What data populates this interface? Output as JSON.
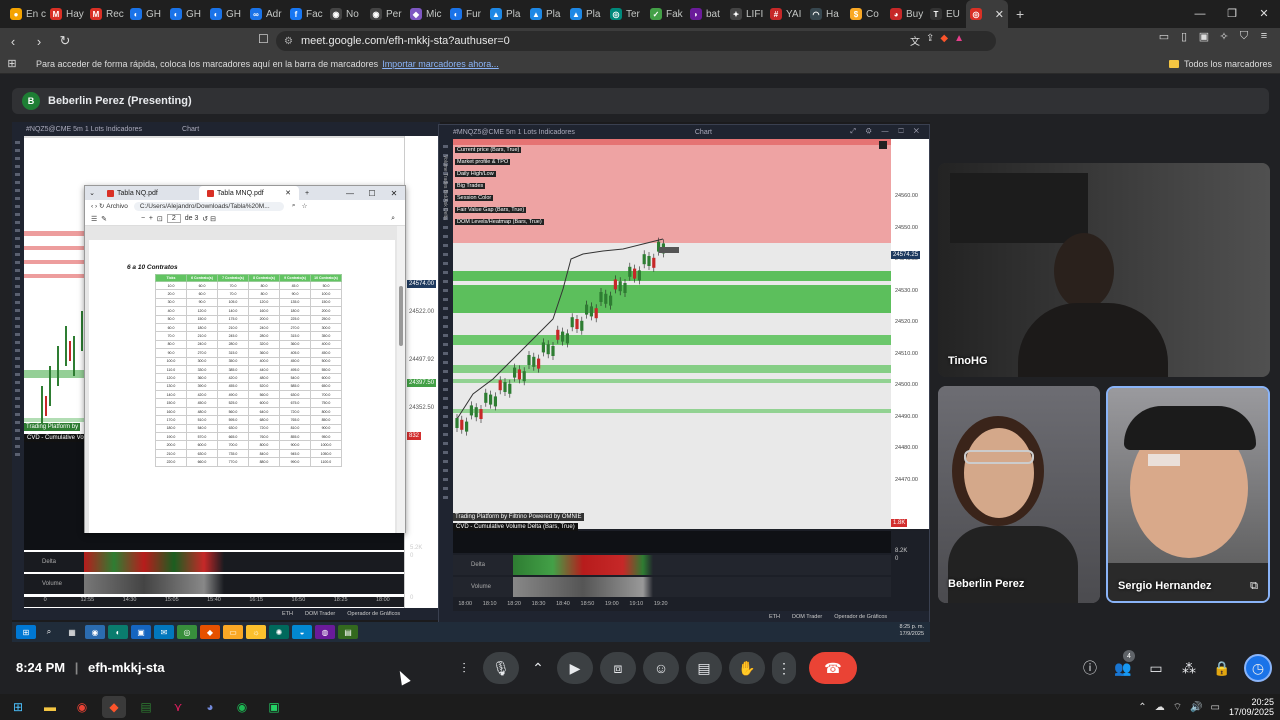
{
  "browser": {
    "tabs": [
      {
        "label": "En c",
        "color": "#f4a300",
        "glyph": "●"
      },
      {
        "label": "Hay",
        "color": "#d93025",
        "glyph": "M"
      },
      {
        "label": "Rec",
        "color": "#d93025",
        "glyph": "M"
      },
      {
        "label": "GH",
        "color": "#1a73e8",
        "glyph": "◐"
      },
      {
        "label": "GH",
        "color": "#1a73e8",
        "glyph": "◐"
      },
      {
        "label": "GH",
        "color": "#1a73e8",
        "glyph": "◐"
      },
      {
        "label": "Adr",
        "color": "#1a73e8",
        "glyph": "∞"
      },
      {
        "label": "Fac",
        "color": "#1877f2",
        "glyph": "f"
      },
      {
        "label": "No",
        "color": "#444",
        "glyph": "◉"
      },
      {
        "label": "Per",
        "color": "#444",
        "glyph": "◉"
      },
      {
        "label": "Mic",
        "color": "#7e57c2",
        "glyph": "◆"
      },
      {
        "label": "Fur",
        "color": "#1a73e8",
        "glyph": "◐"
      },
      {
        "label": "Pla",
        "color": "#1e88e5",
        "glyph": "▲"
      },
      {
        "label": "Pla",
        "color": "#1e88e5",
        "glyph": "▲"
      },
      {
        "label": "Pla",
        "color": "#1e88e5",
        "glyph": "▲"
      },
      {
        "label": "Ter",
        "color": "#00897b",
        "glyph": "◎"
      },
      {
        "label": "Fak",
        "color": "#43a047",
        "glyph": "✓"
      },
      {
        "label": "bat",
        "color": "#6a1b9a",
        "glyph": "◗"
      },
      {
        "label": "LIFI",
        "color": "#444",
        "glyph": "✦"
      },
      {
        "label": "YAI",
        "color": "#c62828",
        "glyph": "#"
      },
      {
        "label": "Ha",
        "color": "#37474f",
        "glyph": "◠"
      },
      {
        "label": "Co",
        "color": "#f9a825",
        "glyph": "$"
      },
      {
        "label": "Buy",
        "color": "#c62828",
        "glyph": "◕"
      },
      {
        "label": "EU",
        "color": "#333",
        "glyph": "T"
      },
      {
        "label": "",
        "color": "#d93025",
        "glyph": "◎",
        "active": true
      }
    ],
    "url": "meet.google.com/efh-mkkj-sta?authuser=0",
    "bookmarks_hint": "Para acceder de forma rápida, coloca los marcadores aquí en la barra de marcadores",
    "bookmarks_link": "Importar marcadores ahora...",
    "all_bookmarks": "Todos los marcadores"
  },
  "meet": {
    "presenter_initial": "B",
    "presenter_label": "Beberlin Perez (Presenting)",
    "meeting_time": "8:24 PM",
    "meeting_code": "efh-mkkj-sta",
    "participants_count": "4",
    "participants": [
      {
        "name": "TinoHG"
      },
      {
        "name": "Beberlin Perez"
      },
      {
        "name": "Sergio Hernandez"
      }
    ],
    "accent": "#8ab4f8",
    "end_call_color": "#ea4335"
  },
  "shared_screen": {
    "left_window": {
      "header": "#NQZ5@CME   5m   1     Lots     Indicadores",
      "chart_label": "Chart",
      "price_tags": [
        "24574.00",
        "24522.00",
        "24497.92",
        "24397.50",
        "24352.50",
        "832"
      ],
      "cvd_label": "CVD - Cumulative Volu",
      "platform_label": "Trading Platform by",
      "delta_label": "Delta",
      "volume_label": "Volume",
      "x_ticks": [
        "0",
        "12:55",
        "14:30",
        "15:05",
        "15:40",
        "16:15",
        "16:50",
        "18:25",
        "18:00"
      ],
      "right_labels": [
        "5.2K",
        "0",
        "0"
      ],
      "status_items": [
        "ETH",
        "DOM Trader",
        "Operador de Gráficos"
      ]
    },
    "pdf_viewer": {
      "tabs": [
        "Tabla NQ.pdf",
        "Tabla MNQ.pdf"
      ],
      "address_label": "Archivo",
      "address": "C:/Users/Alejandro/Downloads/Tabla%20M...",
      "page": "2",
      "page_of": "de 3",
      "section_title": "6 a 10 Contratos",
      "columns": [
        "Ticks",
        "6 Contrato(s)",
        "7 Contrato(s)",
        "8 Contrato(s)",
        "9 Contrato(s)",
        "10 Contrato(s)"
      ],
      "rows": [
        [
          "10.0",
          "60.0",
          "70.0",
          "80.0",
          "45.0",
          "50.0"
        ],
        [
          "20.0",
          "60.0",
          "70.0",
          "80.0",
          "90.0",
          "100.0"
        ],
        [
          "30.0",
          "90.0",
          "105.0",
          "120.0",
          "135.0",
          "150.0"
        ],
        [
          "40.0",
          "120.0",
          "140.0",
          "160.0",
          "180.0",
          "200.0"
        ],
        [
          "50.0",
          "150.0",
          "175.0",
          "200.0",
          "225.0",
          "250.0"
        ],
        [
          "60.0",
          "180.0",
          "210.0",
          "240.0",
          "270.0",
          "300.0"
        ],
        [
          "70.0",
          "210.0",
          "245.0",
          "280.0",
          "315.0",
          "350.0"
        ],
        [
          "80.0",
          "240.0",
          "280.0",
          "320.0",
          "360.0",
          "400.0"
        ],
        [
          "90.0",
          "270.0",
          "315.0",
          "360.0",
          "405.0",
          "450.0"
        ],
        [
          "100.0",
          "300.0",
          "350.0",
          "400.0",
          "450.0",
          "500.0"
        ],
        [
          "110.0",
          "330.0",
          "385.0",
          "440.0",
          "495.0",
          "550.0"
        ],
        [
          "120.0",
          "360.0",
          "420.0",
          "480.0",
          "540.0",
          "600.0"
        ],
        [
          "130.0",
          "390.0",
          "455.0",
          "520.0",
          "585.0",
          "650.0"
        ],
        [
          "140.0",
          "420.0",
          "490.0",
          "560.0",
          "630.0",
          "700.0"
        ],
        [
          "150.0",
          "450.0",
          "525.0",
          "600.0",
          "675.0",
          "750.0"
        ],
        [
          "160.0",
          "480.0",
          "560.0",
          "640.0",
          "720.0",
          "800.0"
        ],
        [
          "170.0",
          "510.0",
          "595.0",
          "680.0",
          "765.0",
          "850.0"
        ],
        [
          "180.0",
          "540.0",
          "630.0",
          "720.0",
          "810.0",
          "900.0"
        ],
        [
          "190.0",
          "570.0",
          "665.0",
          "760.0",
          "855.0",
          "950.0"
        ],
        [
          "200.0",
          "600.0",
          "700.0",
          "800.0",
          "900.0",
          "1000.0"
        ],
        [
          "210.0",
          "630.0",
          "735.0",
          "840.0",
          "945.0",
          "1050.0"
        ],
        [
          "220.0",
          "660.0",
          "770.0",
          "880.0",
          "990.0",
          "1100.0"
        ]
      ]
    },
    "right_window": {
      "header": "#MNQZ5@CME   5m   1     Lots     Indicadores",
      "chart_label": "Chart",
      "indicators": [
        "Current price (Bars, True)",
        "Market profile & TPO",
        "Daily High/Low",
        "Big Trades",
        "Session Color",
        "Fair Value Gap (Bars, True)",
        "DOM Levels/Heatmap (Bars, True)"
      ],
      "vertical_tabs": "Volume  Trades  Bid/Ask  Delta",
      "price_axis": [
        "24574.25",
        "24560.00",
        "24550.00",
        "24540.00",
        "24530.00",
        "24520.00",
        "24510.00",
        "24500.00",
        "24490.00",
        "24480.00",
        "24470.00"
      ],
      "current_price": "24574.25",
      "platform_label": "Trading Platform by Filtrino  Powered by OMNIE",
      "cvd_label": "CVD - Cumulative Volume Delta (Bars, True)",
      "cvd_tag": "1.8K",
      "delta_label": "Delta",
      "volume_label": "Volume",
      "right_labels": [
        "8.2K",
        "0"
      ],
      "x_ticks": [
        "18:00",
        "18:10",
        "18:20",
        "18:30",
        "18:40",
        "18:50",
        "19:00",
        "19:10",
        "19:20"
      ],
      "status_items": [
        "ETH",
        "DOM Trader",
        "Operador de Gráficos"
      ],
      "inner_clock_time": "8:25 p. m.",
      "inner_clock_date": "17/9/2025"
    }
  },
  "taskbar": {
    "time": "20:25",
    "date": "17/09/2025"
  }
}
